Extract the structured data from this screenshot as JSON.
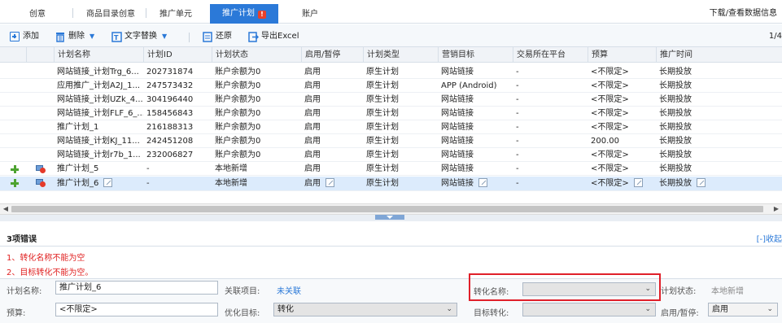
{
  "tabs": [
    {
      "label": "创意"
    },
    {
      "label": "商品目录创意"
    },
    {
      "label": "推广单元"
    },
    {
      "label": "推广计划",
      "badge": "!"
    },
    {
      "label": "账户"
    }
  ],
  "download_link": "下载/查看数据信息",
  "toolbar": {
    "add": "添加",
    "delete": "删除",
    "text_replace": "文字替换",
    "restore": "还原",
    "export": "导出Excel",
    "page_count": "1/4"
  },
  "columns": [
    "计划名称",
    "计划ID",
    "计划状态",
    "启用/暂停",
    "计划类型",
    "营销目标",
    "交易所在平台",
    "预算",
    "推广时间"
  ],
  "rows": [
    {
      "name": "网站链接_计划Trg_6...",
      "id": "202731874",
      "status": "账户余额为0",
      "enabled": "启用",
      "type": "原生计划",
      "goal": "网站链接",
      "platform": "-",
      "budget": "<不限定>",
      "time": "长期投放"
    },
    {
      "name": "应用推广_计划A2J_1...",
      "id": "247573432",
      "status": "账户余额为0",
      "enabled": "启用",
      "type": "原生计划",
      "goal": "APP (Android)",
      "platform": "-",
      "budget": "<不限定>",
      "time": "长期投放"
    },
    {
      "name": "网站链接_计划UZk_4...",
      "id": "304196440",
      "status": "账户余额为0",
      "enabled": "启用",
      "type": "原生计划",
      "goal": "网站链接",
      "platform": "-",
      "budget": "<不限定>",
      "time": "长期投放"
    },
    {
      "name": "网站链接_计划FLF_6_...",
      "id": "158456843",
      "status": "账户余额为0",
      "enabled": "启用",
      "type": "原生计划",
      "goal": "网站链接",
      "platform": "-",
      "budget": "<不限定>",
      "time": "长期投放"
    },
    {
      "name": "推广计划_1",
      "id": "216188313",
      "status": "账户余额为0",
      "enabled": "启用",
      "type": "原生计划",
      "goal": "网站链接",
      "platform": "-",
      "budget": "<不限定>",
      "time": "长期投放"
    },
    {
      "name": "网站链接_计划KJ_11...",
      "id": "242451208",
      "status": "账户余额为0",
      "enabled": "启用",
      "type": "原生计划",
      "goal": "网站链接",
      "platform": "-",
      "budget": "200.00",
      "time": "长期投放"
    },
    {
      "name": "网站链接_计划r7b_1...",
      "id": "232006827",
      "status": "账户余额为0",
      "enabled": "启用",
      "type": "原生计划",
      "goal": "网站链接",
      "platform": "-",
      "budget": "<不限定>",
      "time": "长期投放"
    },
    {
      "name": "推广计划_5",
      "id": "-",
      "status": "本地新增",
      "enabled": "启用",
      "type": "原生计划",
      "goal": "网站链接",
      "platform": "-",
      "budget": "<不限定>",
      "time": "长期投放"
    },
    {
      "name": "推广计划_6",
      "id": "-",
      "status": "本地新增",
      "enabled": "启用",
      "type": "原生计划",
      "goal": "网站链接",
      "platform": "-",
      "budget": "<不限定>",
      "time": "长期投放"
    }
  ],
  "errors": {
    "title": "3项错误",
    "collapse": "[-]收起",
    "items": [
      "1、转化名称不能为空",
      "2、目标转化不能为空。"
    ]
  },
  "form": {
    "plan_name_label": "计划名称:",
    "plan_name_value": "推广计划_6",
    "related_label": "关联项目:",
    "related_value": "未关联",
    "conversion_name_label": "转化名称:",
    "conversion_name_value": "",
    "plan_status_label": "计划状态:",
    "plan_status_value": "本地新增",
    "budget_label": "预算:",
    "budget_value": "<不限定>",
    "opt_target_label": "优化目标:",
    "opt_target_value": "转化",
    "target_conv_label": "目标转化:",
    "target_conv_value": "",
    "enable_label": "启用/暂停:",
    "enable_value": "启用"
  },
  "colors": {
    "accent": "#2b79d8",
    "error": "#e02020",
    "selected_row": "#dcebfc"
  },
  "icons": {
    "add": "plus-box-icon",
    "delete": "trash-icon",
    "replace": "text-replace-icon",
    "restore": "restore-icon",
    "export": "export-icon",
    "new_row": "green-plus-icon",
    "row_error": "monitor-error-icon",
    "edit": "edit-icon"
  }
}
